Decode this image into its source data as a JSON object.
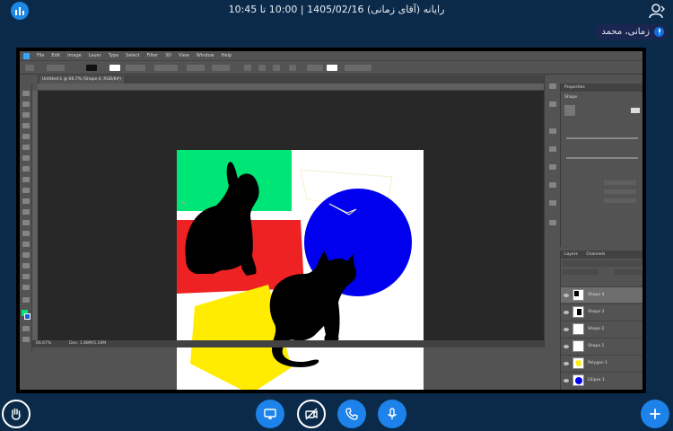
{
  "header": {
    "title": "رایانه (آقای زمانی) 1405/02/16 | 10:00 تا 10:45",
    "presenter_name": "زمانی، محمد"
  },
  "photoshop": {
    "menu": [
      "File",
      "Edit",
      "Image",
      "Layer",
      "Type",
      "Select",
      "Filter",
      "3D",
      "View",
      "Window",
      "Help"
    ],
    "document_tab": "Untitled-1 @ 66.7% (Shape 4, RGB/8#)",
    "status_zoom": "66.67%",
    "status_doc": "Doc: 1.88M/5.16M",
    "properties_title": "Properties",
    "properties_sub": "Shape",
    "layers_tab": "Layers",
    "channels_tab": "Channels",
    "layers": [
      {
        "name": "Shape 4"
      },
      {
        "name": "Shape 3"
      },
      {
        "name": "Shape 2"
      },
      {
        "name": "Shape 1"
      },
      {
        "name": "Polygon 1"
      },
      {
        "name": "Ellipse 1"
      }
    ]
  },
  "colors": {
    "accent": "#1d82e9",
    "background": "#0b2a4a",
    "green": "#00e676",
    "red": "#ee2222",
    "yellow": "#ffec00",
    "blue": "#0000ee"
  },
  "controls": {
    "icons": [
      "hand-icon",
      "screen-share-icon",
      "camera-off-icon",
      "phone-icon",
      "microphone-icon",
      "plus-icon"
    ]
  }
}
